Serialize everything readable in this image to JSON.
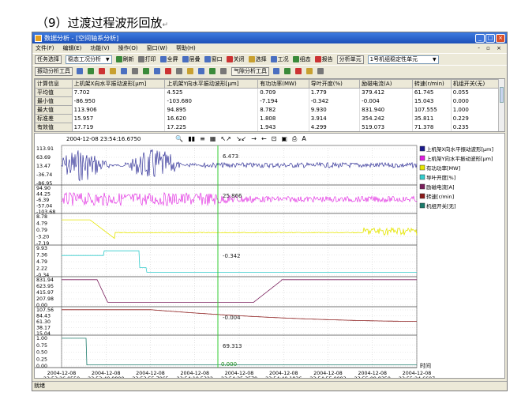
{
  "document": {
    "heading": "（9）过渡过程波形回放",
    "return_mark": "↵"
  },
  "window": {
    "title": "数据分析 - [空间轴系分析]",
    "controls": [
      "_",
      "□",
      "×"
    ]
  },
  "menu": {
    "items": [
      "文件(F)",
      "编辑(E)",
      "功能(V)",
      "操作(O)",
      "窗口(W)",
      "帮助(H)"
    ],
    "right": "- ▫ ×"
  },
  "toolbar1": {
    "task_select": "任务选择",
    "mode": "稳态工况分析",
    "refresh": "刷新",
    "print": "打印",
    "fullscreen": "全屏",
    "tile": "层叠",
    "window": "窗口",
    "close": "关闭",
    "select": "选择",
    "condition": "工况",
    "group": "组态",
    "report": "报告",
    "unit_label": "分析单元",
    "unit_value": "1号机组稳定性单元"
  },
  "toolbar2": {
    "analysis_tools": "振动分析工具",
    "gas_tools": "气隙分析工具"
  },
  "stats": {
    "headers": [
      "计算信息",
      "上机架X向水平振动波形[μm]",
      "上机架Y向水平振动波形[μm]",
      "有功功率(MW)",
      "导叶开度(%)",
      "励磁电流(A)",
      "转速(r/min)",
      "机组开关(无)"
    ],
    "rows": [
      [
        "平均值",
        "7.702",
        "4.525",
        "0.709",
        "1.779",
        "379.412",
        "61.745",
        "0.055"
      ],
      [
        "最小值",
        "-86.950",
        "-103.680",
        "-7.194",
        "-0.342",
        "-0.004",
        "15.043",
        "0.000"
      ],
      [
        "最大值",
        "113.906",
        "94.895",
        "8.782",
        "9.930",
        "831.940",
        "107.555",
        "1.000"
      ],
      [
        "标准差",
        "15.957",
        "16.620",
        "1.808",
        "3.914",
        "354.242",
        "35.811",
        "0.229"
      ],
      [
        "有效值",
        "17.719",
        "17.225",
        "1.943",
        "4.299",
        "519.073",
        "71.378",
        "0.235"
      ]
    ]
  },
  "chart_toolbar": {
    "timestamp": "2004-12-08 23:54:16.6750"
  },
  "legend": {
    "entries": [
      {
        "label": "上机架X向水平振动波形[μm]",
        "color": "#1a1a8c"
      },
      {
        "label": "上机架Y向水平振动波形[μm]",
        "color": "#e01ee0"
      },
      {
        "label": "有功功率[MW]",
        "color": "#e6e600"
      },
      {
        "label": "导叶开度[%]",
        "color": "#33cccc"
      },
      {
        "label": "励磁电流[A]",
        "color": "#7a1f5c"
      },
      {
        "label": "转速[r/min]",
        "color": "#8b1a1a"
      },
      {
        "label": "机组开关[无]",
        "color": "#1a7a6a"
      }
    ]
  },
  "time_axis": {
    "label": "时间",
    "ticks": [
      {
        "date": "2004-12-08",
        "time": "23:53:26.0550"
      },
      {
        "date": "2004-12-08",
        "time": "23:53:40.9800"
      },
      {
        "date": "2004-12-08",
        "time": "23:53:55.7065"
      },
      {
        "date": "2004-12-08",
        "time": "23:54:10.5322"
      },
      {
        "date": "2004-12-08",
        "time": "23:54:25.3579"
      },
      {
        "date": "2004-12-08",
        "time": "23:54:40.1836"
      },
      {
        "date": "2004-12-08",
        "time": "23:54:55.0093"
      },
      {
        "date": "2004-12-08",
        "time": "23:55:09.8350"
      },
      {
        "date": "2004-12-08",
        "time": "23:55:24.6607"
      }
    ]
  },
  "panels": [
    {
      "ticks": [
        "113.91",
        "63.69",
        "13.47",
        "-36.74",
        "-86.95"
      ],
      "cursor_value": "6.473",
      "color": "#1a1a8c"
    },
    {
      "ticks": [
        "94.90",
        "44.25",
        "-6.39",
        "-57.04",
        "-103.68"
      ],
      "cursor_value": "25.866",
      "color": "#e01ee0"
    },
    {
      "ticks": [
        "8.78",
        "4.79",
        "0.79",
        "-3.20",
        "-7.19"
      ],
      "cursor_value": "",
      "color": "#e6e600"
    },
    {
      "ticks": [
        "9.93",
        "7.36",
        "4.79",
        "2.22",
        "-0.34"
      ],
      "cursor_value": "-0.342",
      "color": "#33cccc"
    },
    {
      "ticks": [
        "831.94",
        "623.95",
        "415.97",
        "207.98",
        "0.00"
      ],
      "cursor_value": "",
      "color": "#7a1f5c"
    },
    {
      "ticks": [
        "107.56",
        "84.43",
        "61.30",
        "38.17",
        "15.04"
      ],
      "cursor_value": "-0.004",
      "color": "#8b1a1a"
    },
    {
      "ticks": [
        "1.00",
        "0.75",
        "0.50",
        "0.25",
        "0.00"
      ],
      "cursor_value": "69.313",
      "color": "#1a7a6a"
    }
  ],
  "cursor": {
    "bottom_value": "0.000"
  },
  "status": {
    "text": "就绪"
  }
}
